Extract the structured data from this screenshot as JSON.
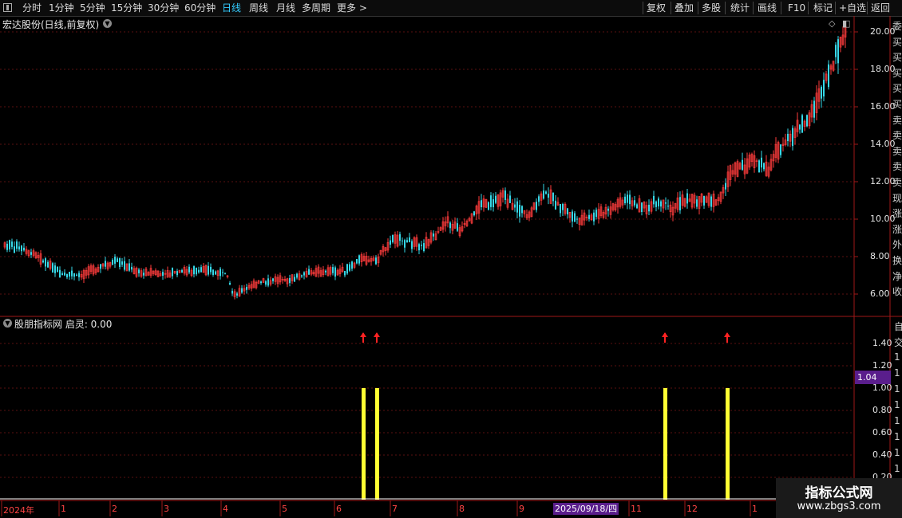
{
  "toolbar": {
    "periods": [
      "分时",
      "1分钟",
      "5分钟",
      "15分钟",
      "30分钟",
      "60分钟",
      "日线",
      "周线",
      "月线",
      "多周期",
      "更多 >"
    ],
    "active_index": 6,
    "actions": [
      "复权",
      "叠加",
      "多股",
      "统计",
      "画线",
      "F10",
      "标记",
      "+自选",
      "返回"
    ]
  },
  "main_chart": {
    "title": "宏达股份(日线,前复权)",
    "y_ticks": [
      "20.00",
      "18.00",
      "16.00",
      "14.00",
      "12.00",
      "10.00",
      "8.00",
      "6.00"
    ],
    "y_min": 5.2,
    "y_max": 20.8,
    "up_color": "#ff3c3c",
    "down_color": "#36d8e8"
  },
  "indicator": {
    "title": "股朋指标网  启灵: 0.00",
    "y_ticks": [
      "1.40",
      "1.20",
      "1.00",
      "0.80",
      "0.60",
      "0.40",
      "0.20"
    ],
    "current_value": "1.04",
    "bar_color": "#ffff33",
    "signals": [
      455,
      472,
      833,
      911
    ]
  },
  "x_axis": {
    "labels": [
      "2024年",
      "1",
      "2",
      "3",
      "4",
      "5",
      "6",
      "7",
      "8",
      "9",
      "11",
      "12",
      "1"
    ],
    "cursor_date": "2025/09/18/四"
  },
  "right_column": {
    "top_chars": [
      "委",
      "买",
      "买",
      "买",
      "买",
      "买",
      "卖",
      "卖",
      "卖",
      "卖",
      "卖",
      "现",
      "涨",
      "涨",
      "外",
      "换",
      "净",
      "收"
    ],
    "bottom_chars": [
      "自",
      "交",
      "1",
      "1",
      "1",
      "1",
      "1",
      "1",
      "1",
      "1"
    ]
  },
  "watermark": {
    "title": "指标公式网",
    "url": "www.zbgs3.com"
  }
}
